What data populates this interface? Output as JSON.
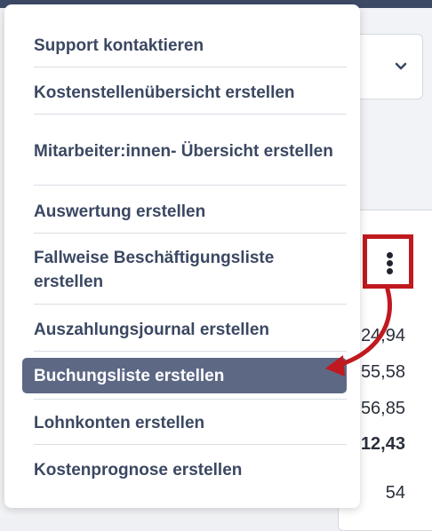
{
  "menu": {
    "items": [
      {
        "label": "Support kontaktieren",
        "selected": false
      },
      {
        "label": "Kostenstellenübersicht erstellen",
        "selected": false
      },
      {
        "label": "Mitarbeiter:innen- Übersicht erstellen",
        "selected": false
      },
      {
        "label": "Auswertung erstellen",
        "selected": false
      },
      {
        "label": "Fallweise Beschäftigungsliste erstellen",
        "selected": false
      },
      {
        "label": "Auszahlungsjournal erstellen",
        "selected": false
      },
      {
        "label": "Buchungsliste erstellen",
        "selected": true
      },
      {
        "label": "Lohnkonten erstellen",
        "selected": false
      },
      {
        "label": "Kostenprognose erstellen",
        "selected": false
      }
    ]
  },
  "background": {
    "values": [
      {
        "text": "24,94",
        "bold": false
      },
      {
        "text": "55,58",
        "bold": false
      },
      {
        "text": "56,85",
        "bold": false
      },
      {
        "text": "12,43",
        "bold": true
      },
      {
        "text": "54",
        "bold": false
      }
    ]
  },
  "annotation": {
    "highlight_color": "#c0191f"
  },
  "icons": {
    "kebab": "more-vertical-icon",
    "chevron": "chevron-down-icon",
    "arrow": "annotation-arrow-icon"
  }
}
